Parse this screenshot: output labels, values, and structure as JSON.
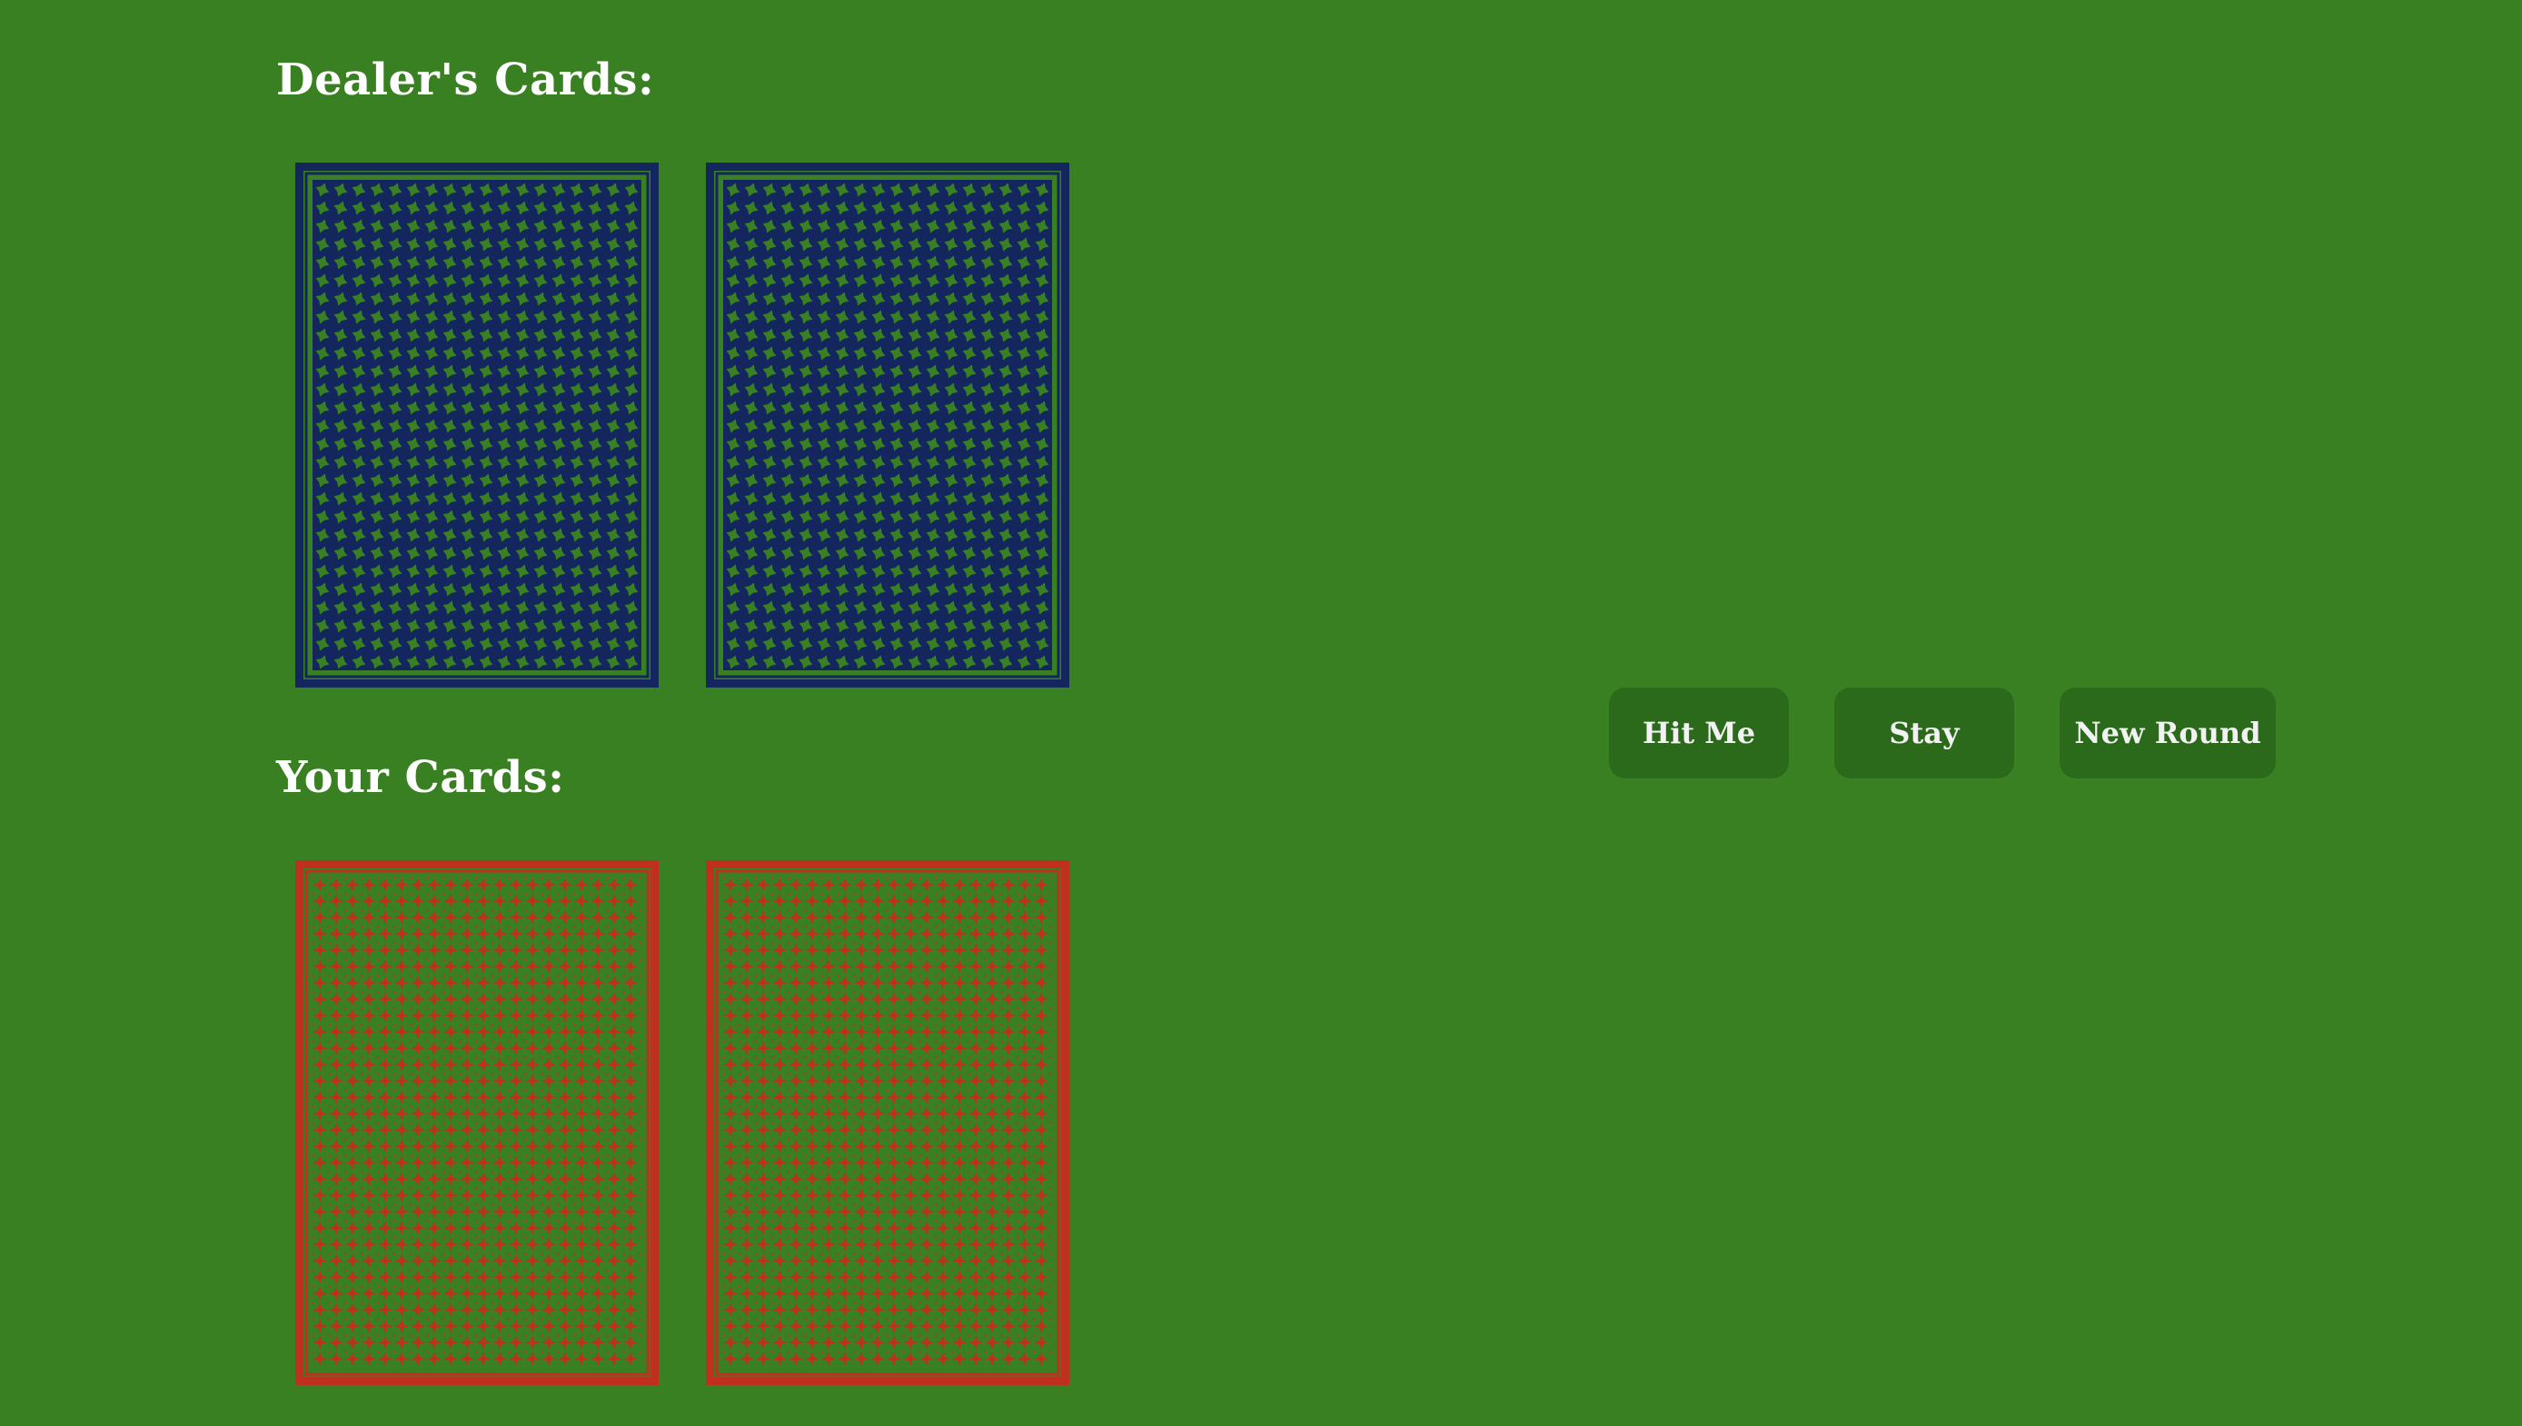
{
  "dealer": {
    "heading": "Dealer's Cards:",
    "cards": [
      {
        "face": "down",
        "back_color": "blue"
      },
      {
        "face": "down",
        "back_color": "blue"
      }
    ]
  },
  "player": {
    "heading": "Your Cards:",
    "cards": [
      {
        "face": "down",
        "back_color": "red"
      },
      {
        "face": "down",
        "back_color": "red"
      }
    ]
  },
  "controls": {
    "hit_label": "Hit Me",
    "stay_label": "Stay",
    "new_round_label": "New Round"
  },
  "colors": {
    "table": "#388022",
    "button": "#2b6a1a",
    "card_back_blue": "#13275e",
    "card_back_red": "#c0301f"
  }
}
